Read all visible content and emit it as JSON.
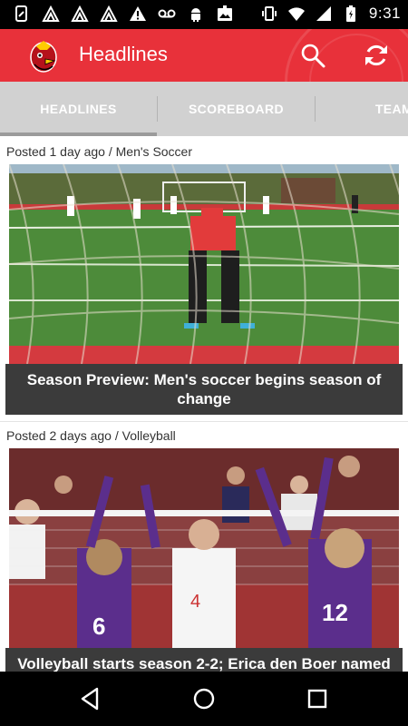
{
  "status_bar": {
    "time": "9:31",
    "left_icons": [
      "notification-icon",
      "triangle-icon",
      "triangle-icon",
      "triangle-icon",
      "warning-icon",
      "voicemail-icon",
      "android-icon",
      "image-icon"
    ],
    "right_icons": [
      "vibrate-icon",
      "wifi-icon",
      "signal-icon",
      "battery-icon"
    ]
  },
  "app_bar": {
    "title": "Headlines",
    "color": "#e8313a"
  },
  "tabs": [
    {
      "label": "HEADLINES",
      "active": true
    },
    {
      "label": "SCOREBOARD",
      "active": false
    },
    {
      "label": "TEAM",
      "active": false
    }
  ],
  "feed": {
    "items": [
      {
        "meta": "Posted 1 day ago / Men's Soccer",
        "caption": "Season Preview: Men's soccer begins season of change"
      },
      {
        "meta": "Posted 2 days ago / Volleyball",
        "caption": "Volleyball starts season 2-2; Erica den Boer named"
      }
    ]
  },
  "nav_bar": {
    "buttons": [
      "back-icon",
      "home-icon",
      "recents-icon"
    ]
  }
}
